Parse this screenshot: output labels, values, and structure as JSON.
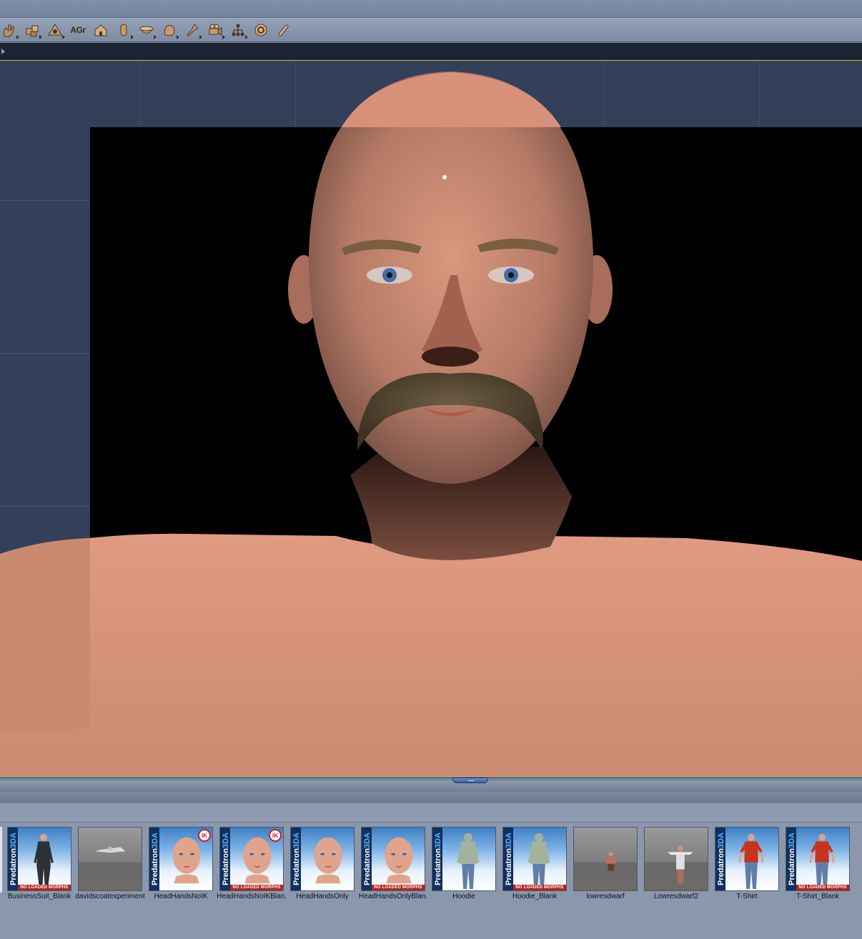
{
  "toolbar": {
    "text_tool_label": "AGr",
    "tools": [
      {
        "icon": "hand-icon"
      },
      {
        "icon": "boxes-icon"
      },
      {
        "icon": "eye-pyramid-icon"
      },
      {
        "icon": "agr-text-icon"
      },
      {
        "icon": "house-icon"
      },
      {
        "icon": "cylinder-icon"
      },
      {
        "icon": "bowl-icon"
      },
      {
        "icon": "glove-icon"
      },
      {
        "icon": "pin-icon"
      },
      {
        "icon": "camera-icon"
      },
      {
        "icon": "hierarchy-icon"
      },
      {
        "icon": "target-icon"
      },
      {
        "icon": "bone-icon"
      }
    ]
  },
  "colors": {
    "skin": "#c98a70",
    "background_panel": "#33405a",
    "accent_line": "#c9b648",
    "predatron_red": "#b3241f"
  },
  "library": {
    "items": [
      {
        "label": "BusinessSuit_Blank",
        "type": "predatron",
        "figure": "suit",
        "no_loaded_morphs": "NO LOADED MORPHS",
        "ik": ""
      },
      {
        "label": "davidscoatexperiment",
        "type": "gray",
        "figure": "coat",
        "no_loaded_morphs": "",
        "ik": ""
      },
      {
        "label": "HeadHandsNoIK",
        "type": "predatron",
        "figure": "head",
        "no_loaded_morphs": "",
        "ik": "IK"
      },
      {
        "label": "HeadHandsNoIKBlan.",
        "type": "predatron",
        "figure": "head",
        "no_loaded_morphs": "NO LOADED MORPHS",
        "ik": "IK"
      },
      {
        "label": "HeadHandsOnly",
        "type": "predatron",
        "figure": "head",
        "no_loaded_morphs": "",
        "ik": ""
      },
      {
        "label": "HeadHandsOnlyBlan.",
        "type": "predatron",
        "figure": "head",
        "no_loaded_morphs": "NO LOADED MORPHS",
        "ik": ""
      },
      {
        "label": "Hoodie",
        "type": "predatron",
        "figure": "hoodie",
        "no_loaded_morphs": "",
        "ik": ""
      },
      {
        "label": "Hoodie_Blank",
        "type": "predatron",
        "figure": "hoodie",
        "no_loaded_morphs": "NO LOADED MORPHS",
        "ik": ""
      },
      {
        "label": "lowresdwarf",
        "type": "gray",
        "figure": "dwarf",
        "no_loaded_morphs": "",
        "ik": ""
      },
      {
        "label": "Lowresdwarf2",
        "type": "gray",
        "figure": "dwarf2",
        "no_loaded_morphs": "",
        "ik": ""
      },
      {
        "label": "T-Shirt",
        "type": "predatron",
        "figure": "tshirt",
        "no_loaded_morphs": "",
        "ik": ""
      },
      {
        "label": "T-Shirt_Blank",
        "type": "predatron",
        "figure": "tshirt",
        "no_loaded_morphs": "NO LOADED MORPHS",
        "ik": ""
      }
    ],
    "brand_prefix": "Predatron",
    "brand_suffix": "3DA"
  }
}
